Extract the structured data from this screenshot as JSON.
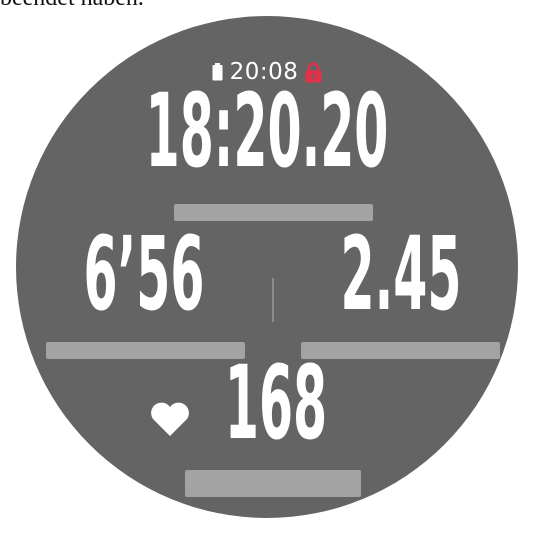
{
  "caption": {
    "text": "beendet haben."
  },
  "status_bar": {
    "time": "20:08",
    "battery_icon": "battery-icon",
    "lock_icon": "lock-icon",
    "lock_color": "#e0334a"
  },
  "fields": {
    "elapsed_time": "18:20.20",
    "pace": "6’56",
    "distance": "2.45",
    "heart_rate": "168"
  },
  "colors": {
    "face_background": "#646464",
    "text": "#ffffff",
    "field_bar": "#a3a3a3"
  },
  "icons": {
    "heart": "heart-icon"
  }
}
